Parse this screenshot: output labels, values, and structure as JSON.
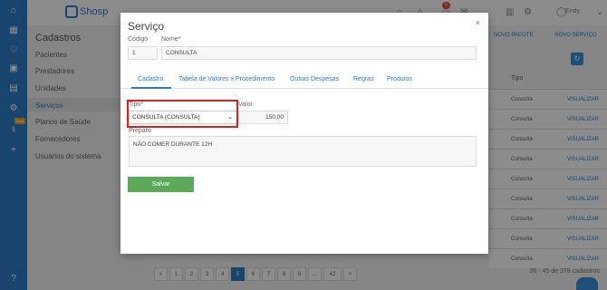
{
  "app": {
    "logo_text": "Shosp",
    "user_name": "Endy",
    "notification_count": "0"
  },
  "sidebar": {
    "title": "Cadastros",
    "items": [
      {
        "label": "Pacientes"
      },
      {
        "label": "Prestadores"
      },
      {
        "label": "Unidades"
      },
      {
        "label": "Serviços"
      },
      {
        "label": "Planos de Saúde"
      },
      {
        "label": "Fornecedores"
      },
      {
        "label": "Usuários do sistema"
      }
    ],
    "rail_badge": "Beta"
  },
  "background": {
    "new_package_label": "NOVO PACOTE",
    "new_service_label": "NOVO SERVIÇO",
    "table_header": "Tipo",
    "rows": [
      {
        "tipo": "Consulta",
        "action": "VISUALIZAR"
      },
      {
        "tipo": "Consulta",
        "action": "VISUALIZAR"
      },
      {
        "tipo": "Consulta",
        "action": "VISUALIZAR"
      },
      {
        "tipo": "Consulta",
        "action": "VISUALIZAR"
      },
      {
        "tipo": "Consulta",
        "action": "VISUALIZAR"
      },
      {
        "tipo": "Consulta",
        "action": "VISUALIZAR"
      },
      {
        "tipo": "Consulta",
        "action": "VISUALIZAR"
      },
      {
        "tipo": "Consulta",
        "action": "VISUALIZAR"
      },
      {
        "tipo": "Consulta",
        "action": "VISUALIZAR"
      }
    ],
    "pager": [
      "<",
      "1",
      "2",
      "3",
      "4",
      "5",
      "6",
      "7",
      "8",
      "9",
      "...",
      "42",
      ">"
    ],
    "pager_active": "5",
    "pager_total": "36 - 45 de 378 cadastros"
  },
  "modal": {
    "title": "Serviço",
    "close": "×",
    "codigo_label": "Código",
    "codigo_value": "1",
    "nome_label": "Nome*",
    "nome_value": "CONSULTA",
    "tabs": [
      {
        "label": "Cadastro"
      },
      {
        "label": "Tabela de Valores x Procedimento"
      },
      {
        "label": "Outras Despesas"
      },
      {
        "label": "Regras"
      },
      {
        "label": "Produtos"
      }
    ],
    "tipo_label": "Tipo*",
    "tipo_value": "CONSULTA (CONSULTA)",
    "valor_label": "Valor",
    "valor_value": "150,00",
    "preparo_label": "Preparo",
    "preparo_value": "NÃO COMER DURANTE 12H",
    "save_label": "Salvar"
  }
}
